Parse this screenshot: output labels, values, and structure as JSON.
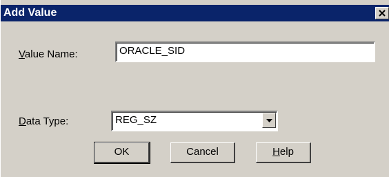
{
  "dialog": {
    "title": "Add Value",
    "close_icon": "close-icon"
  },
  "value_name": {
    "label_accel": "V",
    "label_rest": "alue Name:",
    "value": "ORACLE_SID"
  },
  "data_type": {
    "label_accel": "D",
    "label_rest": "ata Type:",
    "selected": "REG_SZ",
    "dropdown_icon": "chevron-down-icon"
  },
  "buttons": {
    "ok": "OK",
    "cancel": "Cancel",
    "help_accel": "H",
    "help_rest": "elp"
  },
  "colors": {
    "titlebar": "#0a246a",
    "face": "#d4d0c8"
  }
}
